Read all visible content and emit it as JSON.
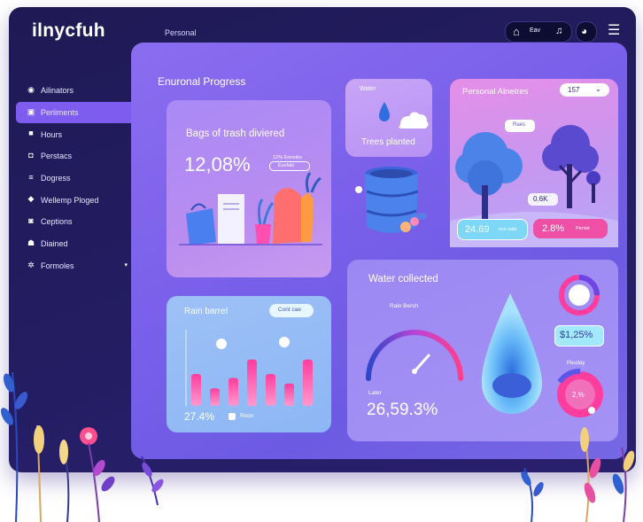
{
  "app": {
    "brand": "ilnycfuh",
    "page_label": "Personal"
  },
  "topbar": {
    "chip_label": "Eav"
  },
  "sidebar": {
    "items": [
      {
        "label": "Ailinators",
        "icon": "wifi-icon"
      },
      {
        "label": "Periiments",
        "icon": "document-icon",
        "active": true
      },
      {
        "label": "Hours",
        "icon": "folder-icon"
      },
      {
        "label": "Perstacs",
        "icon": "clock-icon"
      },
      {
        "label": "Dogress",
        "icon": "list-icon"
      },
      {
        "label": "Wellemp Ploged",
        "icon": "shield-icon"
      },
      {
        "label": "Ceptions",
        "icon": "chat-icon"
      },
      {
        "label": "Diained",
        "icon": "user-icon"
      },
      {
        "label": "Formoles",
        "icon": "grid-icon"
      }
    ]
  },
  "main": {
    "section_title": "Enuronal Progress"
  },
  "trash_card": {
    "title": "Bags of trash diviered",
    "value": "12,08%",
    "tag_line1": "12% Eresotiu",
    "tag_line2": "Eucfals"
  },
  "water_card": {
    "title": "Water",
    "subtitle": "Trees planted"
  },
  "nature_card": {
    "title": "Personal Alnetres",
    "dropdown": "157",
    "tooltip": "Raes",
    "tree_label": "0.6K",
    "stat_left": "24.69",
    "stat_left_unit": "eco sale",
    "stat_right": "2.8%",
    "stat_right_unit": "Paniat"
  },
  "rain_card": {
    "title": "Rain barrel",
    "button": "Cont cae",
    "value": "27.4%",
    "legend": "Roon",
    "bars": [
      0.4,
      0.22,
      0.35,
      0.58,
      0.4,
      0.28,
      0.58
    ]
  },
  "collect_card": {
    "title": "Water collected",
    "gauge_label": "Rain Bersh",
    "low_label": "Later",
    "value": "26,59.3%",
    "stat": "$1,25%",
    "stat2_label": "Peuday",
    "stat2_value": "2,%"
  },
  "colors": {
    "accent": "#7f5cf0",
    "pink": "#ff4fa6",
    "frame": "#211b5c"
  }
}
